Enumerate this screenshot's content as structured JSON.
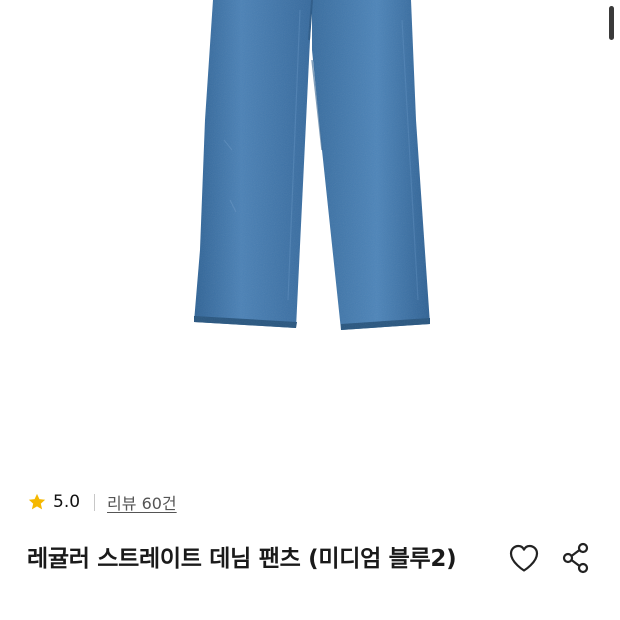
{
  "product": {
    "image_alt": "denim-pants-photo",
    "title": "레귤러 스트레이트 데님 팬츠 (미디엄 블루2)"
  },
  "rating": {
    "score": "5.0",
    "review_link": "리뷰 60건",
    "star_color": "#f5b800"
  },
  "actions": {
    "wish_icon": "heart-outline-icon",
    "share_icon": "share-icon"
  },
  "colors": {
    "denim": "#3f74a8",
    "text": "#1a1a1a"
  }
}
